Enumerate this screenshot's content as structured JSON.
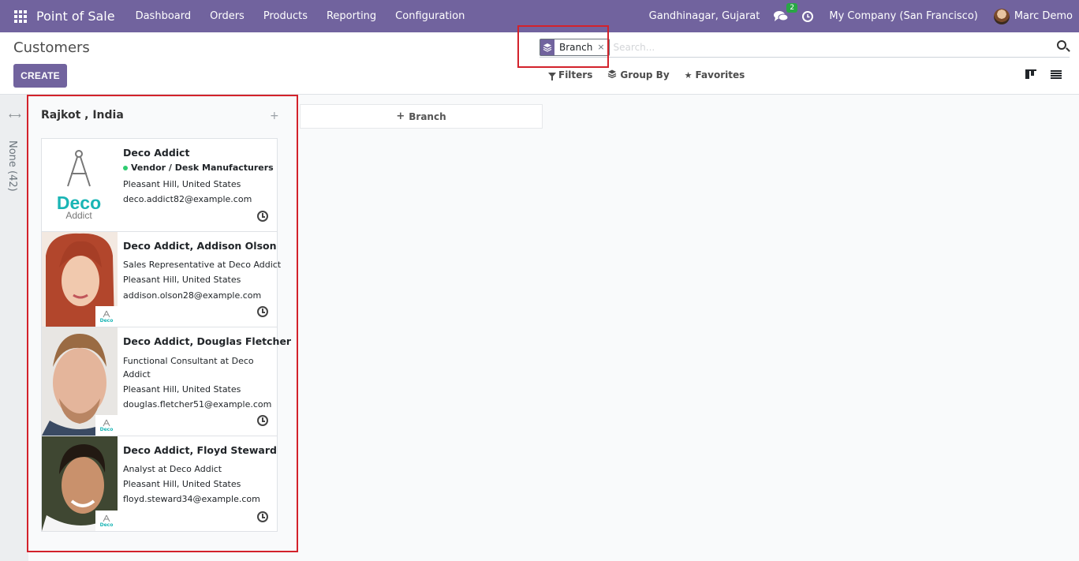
{
  "navbar": {
    "app_name": "Point of Sale",
    "menu": [
      "Dashboard",
      "Orders",
      "Products",
      "Reporting",
      "Configuration"
    ],
    "location": "Gandhinagar, Gujarat",
    "messages_count": "2",
    "company": "My Company (San Francisco)",
    "user": "Marc Demo"
  },
  "control_panel": {
    "title": "Customers",
    "create_label": "CREATE",
    "search": {
      "facet_label": "Branch",
      "facet_remove": "×",
      "placeholder": "Search..."
    },
    "filters_label": "Filters",
    "group_by_label": "Group By",
    "favorites_label": "Favorites"
  },
  "kanban": {
    "folded_column_label": "None (42)",
    "column": {
      "title": "Rajkot , India",
      "quick_create": "+"
    },
    "add_column_label": "Branch",
    "cards": [
      {
        "name": "Deco Addict",
        "tag": "Vendor / Desk Manufacturers",
        "function": "",
        "address": "Pleasant Hill, United States",
        "email": "deco.addict82@example.com",
        "logo_word": "Deco",
        "logo_sub": "Addict"
      },
      {
        "name": "Deco Addict, Addison Olson",
        "function": "Sales Representative at Deco Addict",
        "address": "Pleasant Hill, United States",
        "email": "addison.olson28@example.com",
        "badge_text": "Deco"
      },
      {
        "name": "Deco Addict, Douglas Fletcher",
        "function": "Functional Consultant at Deco Addict",
        "address": "Pleasant Hill, United States",
        "email": "douglas.fletcher51@example.com",
        "badge_text": "Deco"
      },
      {
        "name": "Deco Addict, Floyd Steward",
        "function": "Analyst at Deco Addict",
        "address": "Pleasant Hill, United States",
        "email": "floyd.steward34@example.com",
        "badge_text": "Deco"
      }
    ]
  },
  "colors": {
    "brand": "#71639e",
    "highlight": "#d3222b",
    "tag_dot": "#2ecc71",
    "logo_teal": "#1ab5b5"
  }
}
